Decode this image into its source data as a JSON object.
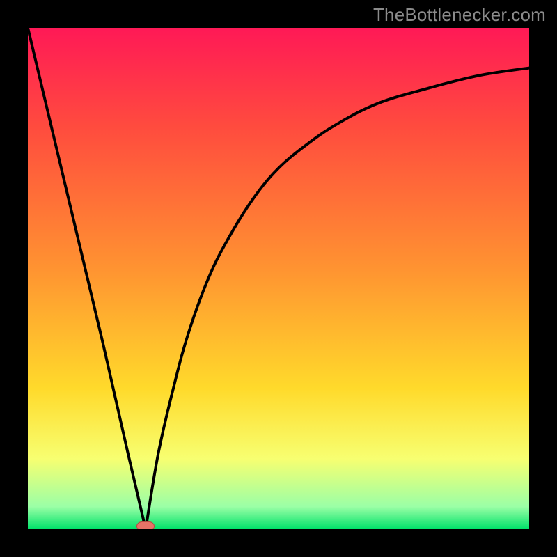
{
  "watermark": "TheBottlenecker.com",
  "colors": {
    "top": "#ff1956",
    "mid_red": "#ff4c3e",
    "orange": "#ff9331",
    "yellow": "#ffda2b",
    "pale_yellow": "#f7ff71",
    "light_green": "#9bffa6",
    "green": "#00e26a",
    "curve": "#000000",
    "marker_fill": "#e77367",
    "marker_stroke": "#b34a41",
    "frame": "#000000"
  },
  "chart_data": {
    "type": "line",
    "title": "",
    "xlabel": "",
    "ylabel": "",
    "xlim": [
      0,
      1
    ],
    "ylim": [
      0,
      1
    ],
    "series": [
      {
        "name": "left-linear",
        "x": [
          0.0,
          0.05,
          0.1,
          0.15,
          0.2,
          0.235
        ],
        "y": [
          1.0,
          0.79,
          0.58,
          0.37,
          0.15,
          0.0
        ]
      },
      {
        "name": "right-curve",
        "x": [
          0.235,
          0.26,
          0.29,
          0.32,
          0.36,
          0.4,
          0.45,
          0.5,
          0.56,
          0.62,
          0.7,
          0.8,
          0.9,
          1.0
        ],
        "y": [
          0.0,
          0.15,
          0.28,
          0.39,
          0.5,
          0.58,
          0.66,
          0.72,
          0.77,
          0.81,
          0.85,
          0.88,
          0.905,
          0.92
        ]
      }
    ],
    "marker": {
      "x": 0.235,
      "y": 0.005
    },
    "gradient_stops": [
      {
        "pos": 0.0,
        "color": "#ff1956"
      },
      {
        "pos": 0.2,
        "color": "#ff4c3e"
      },
      {
        "pos": 0.48,
        "color": "#ff9331"
      },
      {
        "pos": 0.72,
        "color": "#ffda2b"
      },
      {
        "pos": 0.86,
        "color": "#f7ff71"
      },
      {
        "pos": 0.955,
        "color": "#9bffa6"
      },
      {
        "pos": 1.0,
        "color": "#00e26a"
      }
    ]
  }
}
